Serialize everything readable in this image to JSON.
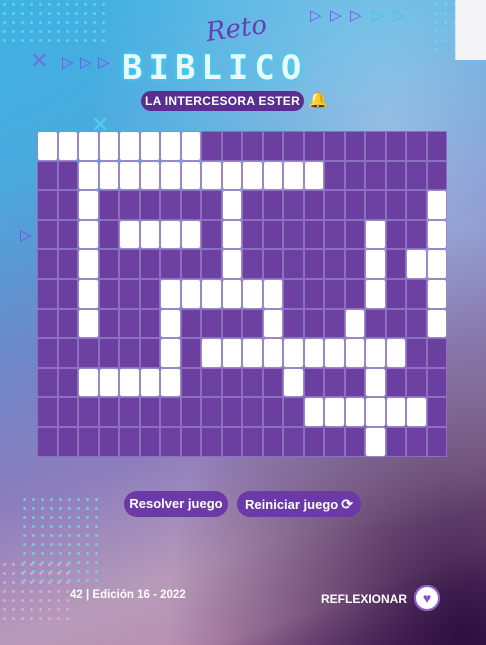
{
  "brand": {
    "script": "Reto",
    "title": "BIBLICO"
  },
  "puzzle": {
    "subtitle": "LA INTERCESORA ESTER",
    "rows": [
      "WWWWWWWW............",
      "..WWWWWWWWWWWW......",
      "..W......W.........W",
      "..W.WWWW.W......W..W",
      "..W......W......W.WW",
      "..W...WWWWWW....W..W",
      "..W...W....W...W...W",
      "......W.WWWWWWWWWW..",
      "..WWWWW.....W...W...",
      ".............WWWWWW.",
      "................W..."
    ]
  },
  "buttons": {
    "solve": "Resolver juego",
    "reset": "Reiniciar juego"
  },
  "footer": {
    "page_info": "42 | Edición 16 - 2022",
    "reflect": "REFLEXIONAR"
  }
}
